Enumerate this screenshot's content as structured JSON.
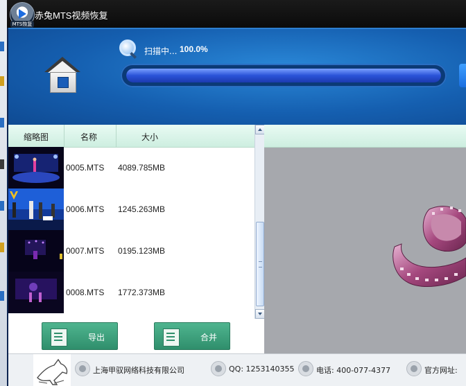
{
  "app": {
    "title": "赤兔MTS视频恢复",
    "logo_badge": "MTS恢复"
  },
  "scan": {
    "label": "扫描中...",
    "percent_text": "100.0%",
    "progress": 1.0
  },
  "list": {
    "columns": [
      "缩略图",
      "名称",
      "大小"
    ],
    "rows": [
      {
        "name": "0005.MTS",
        "size": "4089.785MB"
      },
      {
        "name": "0006.MTS",
        "size": "1245.263MB"
      },
      {
        "name": "0007.MTS",
        "size": "0195.123MB"
      },
      {
        "name": "0008.MTS",
        "size": "1772.373MB"
      }
    ]
  },
  "buttons": {
    "export": "导出",
    "merge": "合并"
  },
  "footer": {
    "company": "上海甲驭网络科技有限公司",
    "qq": "QQ: 1253140355",
    "phone": "电话: 400-077-4377",
    "website": "官方网址:"
  },
  "colors": {
    "header_blue": "#155fb0",
    "button_green": "#2f8f6c",
    "progress_blue": "#2a53d8"
  }
}
